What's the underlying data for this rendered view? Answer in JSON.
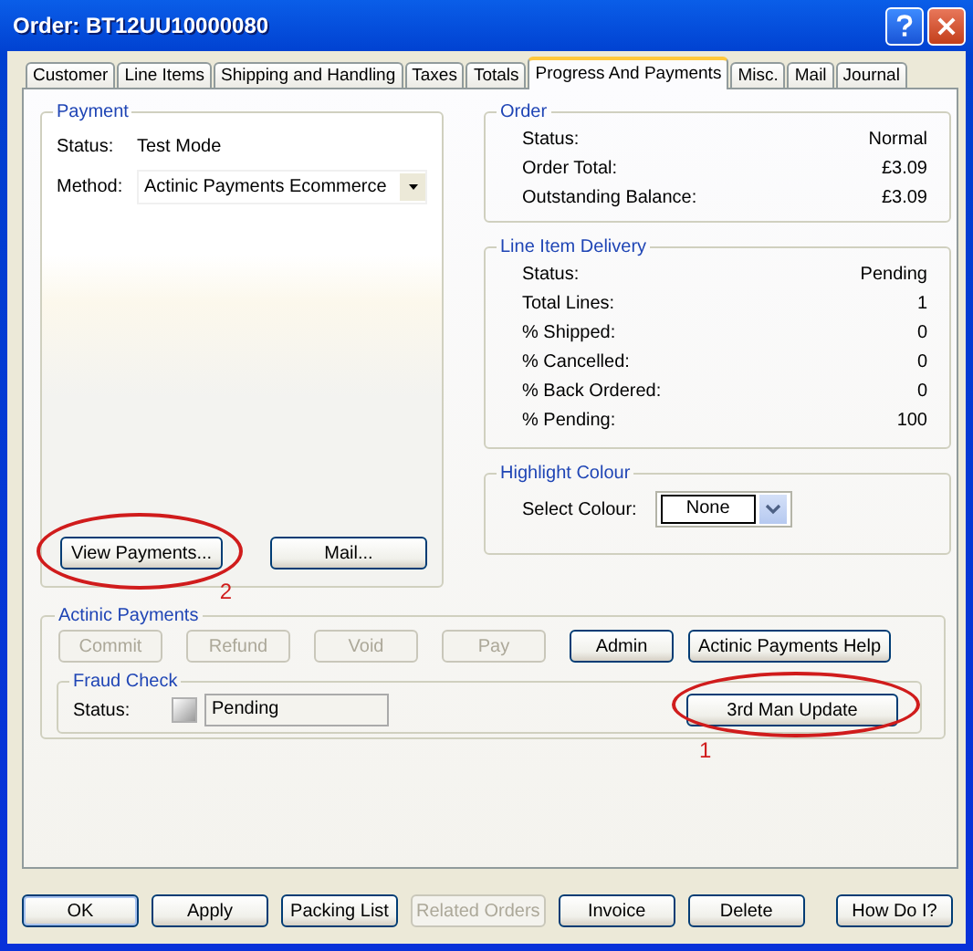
{
  "window": {
    "title": "Order: BT12UU10000080"
  },
  "tabs": [
    {
      "label": "Customer",
      "selected": false
    },
    {
      "label": "Line Items",
      "selected": false
    },
    {
      "label": "Shipping and Handling",
      "selected": false
    },
    {
      "label": "Taxes",
      "selected": false
    },
    {
      "label": "Totals",
      "selected": false
    },
    {
      "label": "Progress And Payments",
      "selected": true
    },
    {
      "label": "Misc.",
      "selected": false
    },
    {
      "label": "Mail",
      "selected": false
    },
    {
      "label": "Journal",
      "selected": false
    }
  ],
  "payment": {
    "title": "Payment",
    "status_label": "Status:",
    "status_value": "Test Mode",
    "method_label": "Method:",
    "method_value": "Actinic Payments Ecommerce",
    "buttons": [
      {
        "label": "View Payments...",
        "disabled": false,
        "annotation": "2"
      },
      {
        "label": "Mail...",
        "disabled": false
      }
    ]
  },
  "order": {
    "title": "Order",
    "rows": [
      {
        "label": "Status:",
        "value": "Normal"
      },
      {
        "label": "Order Total:",
        "value": "£3.09"
      },
      {
        "label": "Outstanding Balance:",
        "value": "£3.09"
      }
    ]
  },
  "line_item_delivery": {
    "title": "Line Item Delivery",
    "rows": [
      {
        "label": "Status:",
        "value": "Pending"
      },
      {
        "label": "Total Lines:",
        "value": "1"
      },
      {
        "label": "% Shipped:",
        "value": "0"
      },
      {
        "label": "% Cancelled:",
        "value": "0"
      },
      {
        "label": "% Back Ordered:",
        "value": "0"
      },
      {
        "label": "% Pending:",
        "value": "100"
      }
    ]
  },
  "highlight_colour": {
    "title": "Highlight Colour",
    "label": "Select Colour:",
    "value": "None"
  },
  "actinic_payments": {
    "title": "Actinic Payments",
    "buttons": [
      {
        "label": "Commit",
        "disabled": true
      },
      {
        "label": "Refund",
        "disabled": true
      },
      {
        "label": "Void",
        "disabled": true
      },
      {
        "label": "Pay",
        "disabled": true
      },
      {
        "label": "Admin",
        "disabled": false
      },
      {
        "label": "Actinic Payments Help",
        "disabled": false
      }
    ],
    "fraud_check": {
      "title": "Fraud Check",
      "status_label": "Status:",
      "status_value": "Pending",
      "button": {
        "label": "3rd Man Update",
        "disabled": false,
        "annotation": "1"
      }
    }
  },
  "buttons": [
    {
      "label": "OK",
      "disabled": false,
      "default": true
    },
    {
      "label": "Apply",
      "disabled": false,
      "default": false
    },
    {
      "label": "Packing List",
      "disabled": false,
      "default": false
    },
    {
      "label": "Related Orders",
      "disabled": true,
      "default": false
    },
    {
      "label": "Invoice",
      "disabled": false,
      "default": false
    },
    {
      "label": "Delete",
      "disabled": false,
      "default": false
    }
  ],
  "help_button": "How Do I?"
}
